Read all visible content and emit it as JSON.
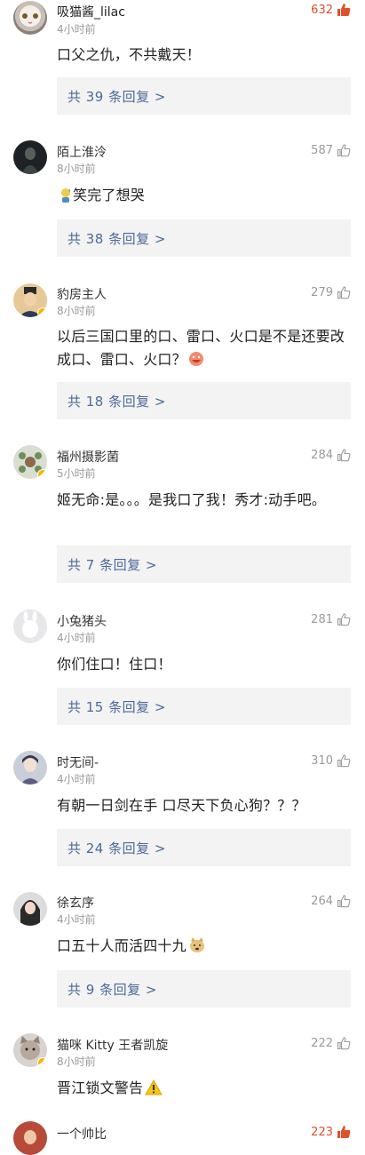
{
  "comments": [
    {
      "username": "吸猫酱_lilac",
      "time": "4小时前",
      "likes": "632",
      "text": "口父之仇，不共戴天！",
      "replies": "共 39 条回复 >"
    },
    {
      "username": "陌上淮泠",
      "time": "8小时前",
      "likes": "587",
      "text": "笑完了想哭",
      "replies": "共 38 条回复 >"
    },
    {
      "username": "豹房主人",
      "time": "8小时前",
      "likes": "279",
      "text": "以后三国口里的口、雷口、火口是不是还要改成口、雷口、火口？",
      "replies": "共 18 条回复 >"
    },
    {
      "username": "福州摄影菌",
      "time": "5小时前",
      "likes": "284",
      "text": "姬无命:是。。。是我口了我！秀才:动手吧。",
      "replies": "共 7 条回复 >"
    },
    {
      "username": "小兔猪头",
      "time": "4小时前",
      "likes": "281",
      "text": "你们住口！住口！",
      "replies": "共 15 条回复 >"
    },
    {
      "username": "时无间-",
      "time": "4小时前",
      "likes": "310",
      "text": "有朝一日剑在手 口尽天下负心狗？？？",
      "replies": "共 24 条回复 >"
    },
    {
      "username": "徐玄序",
      "time": "4小时前",
      "likes": "264",
      "text": "口五十人而活四十九",
      "replies": "共 9 条回复 >"
    },
    {
      "username": "猫咪 Kitty 王者凯旋",
      "time": "8小时前",
      "likes": "222",
      "text": "晋江锁文警告",
      "replies": ""
    },
    {
      "username": "一个帅比",
      "time": "",
      "likes": "223",
      "text": "",
      "replies": ""
    }
  ],
  "icons": {
    "like": "thumbs-up-icon"
  },
  "colors": {
    "hot_like": "#e0502b",
    "reply_link": "#4b6a9b"
  }
}
